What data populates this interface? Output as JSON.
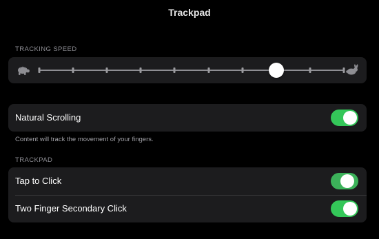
{
  "page": {
    "title": "Trackpad"
  },
  "tracking_speed": {
    "header": "TRACKING SPEED",
    "tick_count": 10,
    "value_fraction": 0.778,
    "slow_icon": "turtle-icon",
    "fast_icon": "rabbit-icon"
  },
  "scrolling": {
    "natural_scrolling_label": "Natural Scrolling",
    "natural_scrolling_on": true,
    "footer": "Content will track the movement of your fingers."
  },
  "trackpad": {
    "header": "TRACKPAD",
    "tap_to_click_label": "Tap to Click",
    "tap_to_click_on": true,
    "two_finger_label": "Two Finger Secondary Click",
    "two_finger_on": true
  },
  "colors": {
    "background": "#000000",
    "group_background": "#1c1c1e",
    "toggle_on": "#34c759",
    "secondary_text": "#8d8d93"
  }
}
